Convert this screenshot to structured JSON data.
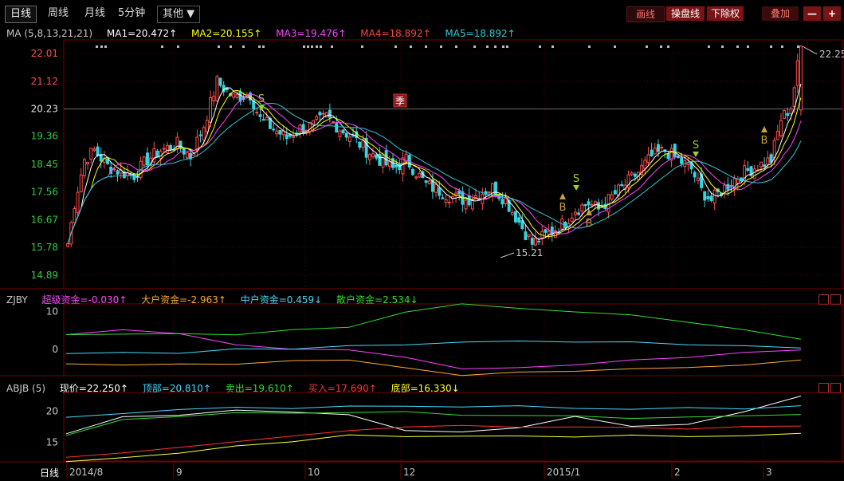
{
  "toolbar": {
    "tabs": [
      "日线",
      "周线",
      "月线",
      "5分钟",
      "其他 ▼"
    ],
    "draw_label": "画线",
    "operate_label": "操盘线",
    "exright_label": "下除权",
    "overlay_label": "叠加",
    "minus_label": "—",
    "plus_label": "+"
  },
  "ma_legend": {
    "prefix": "MA (5,8,13,21,21)",
    "items": [
      {
        "text": "MA1=20.472↑",
        "color": "#ffffff"
      },
      {
        "text": "MA2=20.155↑",
        "color": "#ffff00"
      },
      {
        "text": "MA3=19.476↑",
        "color": "#ff44ff"
      },
      {
        "text": "MA4=18.892↑",
        "color": "#ff4040"
      },
      {
        "text": "MA5=18.892↑",
        "color": "#2ec8d8"
      }
    ]
  },
  "zjby_legend": {
    "prefix": "ZJBY",
    "items": [
      {
        "text": "超级资金=-0.030↑",
        "color": "#ff44ff"
      },
      {
        "text": "大户资金=-2.963↑",
        "color": "#ffaa33"
      },
      {
        "text": "中户资金=0.459↓",
        "color": "#4ad8ff"
      },
      {
        "text": "散户资金=2.534↓",
        "color": "#33dd33"
      }
    ]
  },
  "abjb_legend": {
    "prefix": "ABJB (5)",
    "items": [
      {
        "text": "现价=22.250↑",
        "color": "#ffffff"
      },
      {
        "text": "顶部=20.810↑",
        "color": "#4ad8ff"
      },
      {
        "text": "卖出=19.610↑",
        "color": "#33dd33"
      },
      {
        "text": "买入=17.690↑",
        "color": "#ff3333"
      },
      {
        "text": "底部=16.330↓",
        "color": "#ffff33"
      }
    ]
  },
  "x_axis": {
    "label": "日线",
    "ticks": [
      "2014/8",
      "9",
      "10",
      "12",
      "2015/1",
      "2",
      "3"
    ]
  },
  "chart_data": [
    {
      "type": "candlestick",
      "y_ticks": [
        22.01,
        21.12,
        20.23,
        19.36,
        18.45,
        17.56,
        16.67,
        15.78,
        14.89
      ],
      "ylim": [
        14.45,
        22.45
      ],
      "annotations": [
        "22.25",
        "15.21",
        "季",
        "S",
        "B"
      ],
      "price_path": [
        [
          0,
          15.9
        ],
        [
          2,
          17.2
        ],
        [
          5,
          18.6
        ],
        [
          8,
          18.9
        ],
        [
          12,
          18.4
        ],
        [
          16,
          18.2
        ],
        [
          20,
          18.1
        ],
        [
          24,
          18.6
        ],
        [
          28,
          18.9
        ],
        [
          33,
          19.1
        ],
        [
          37,
          18.7
        ],
        [
          41,
          19.7
        ],
        [
          45,
          21.1
        ],
        [
          50,
          20.6
        ],
        [
          55,
          20.7
        ],
        [
          58,
          19.9
        ],
        [
          62,
          19.6
        ],
        [
          66,
          19.3
        ],
        [
          70,
          19.6
        ],
        [
          74,
          19.7
        ],
        [
          78,
          20.0
        ],
        [
          82,
          19.6
        ],
        [
          86,
          19.3
        ],
        [
          90,
          18.9
        ],
        [
          94,
          18.6
        ],
        [
          98,
          18.3
        ],
        [
          102,
          18.6
        ],
        [
          105,
          18.2
        ],
        [
          108,
          17.8
        ],
        [
          112,
          17.6
        ],
        [
          116,
          17.4
        ],
        [
          120,
          17.3
        ],
        [
          124,
          17.5
        ],
        [
          128,
          17.7
        ],
        [
          132,
          17.3
        ],
        [
          136,
          16.6
        ],
        [
          140,
          15.9
        ],
        [
          143,
          16.1
        ],
        [
          146,
          16.3
        ],
        [
          150,
          16.6
        ],
        [
          153,
          17.0
        ],
        [
          157,
          17.2
        ],
        [
          160,
          17.0
        ],
        [
          164,
          17.4
        ],
        [
          168,
          17.8
        ],
        [
          172,
          18.2
        ],
        [
          176,
          18.7
        ],
        [
          180,
          18.9
        ],
        [
          184,
          18.6
        ],
        [
          188,
          18.3
        ],
        [
          191,
          17.6
        ],
        [
          194,
          17.3
        ],
        [
          197,
          17.6
        ],
        [
          200,
          17.9
        ],
        [
          204,
          18.2
        ],
        [
          208,
          18.4
        ],
        [
          212,
          18.6
        ],
        [
          215,
          19.9
        ],
        [
          218,
          20.3
        ],
        [
          221,
          22.25
        ]
      ],
      "candle_count": 222
    },
    {
      "type": "line",
      "ylim": [
        -7,
        12
      ],
      "y_ticks": [
        10,
        0
      ],
      "series": [
        {
          "name": "超级资金",
          "color": "#ff44ff",
          "values": [
            4,
            5,
            4,
            1,
            0,
            0,
            -2,
            -5,
            -5,
            -4,
            -3,
            -2,
            -1,
            0
          ]
        },
        {
          "name": "大户资金",
          "color": "#ffaa33",
          "values": [
            -4,
            -4,
            -4,
            -4,
            -3,
            -3,
            -5,
            -7,
            -6,
            -6,
            -5,
            -5,
            -4,
            -3
          ]
        },
        {
          "name": "中户资金",
          "color": "#4ad8ff",
          "values": [
            -1,
            -1,
            -1,
            0,
            0,
            1,
            1,
            2,
            2,
            2,
            2,
            1,
            1,
            0.5
          ]
        },
        {
          "name": "散户资金",
          "color": "#33dd33",
          "values": [
            4,
            4,
            4,
            4,
            5,
            6,
            10,
            12,
            11,
            10,
            9,
            7,
            5,
            2.5
          ]
        }
      ]
    },
    {
      "type": "line",
      "ylim": [
        12,
        23
      ],
      "y_ticks": [
        20,
        15
      ],
      "series": [
        {
          "name": "现价",
          "color": "#ffffff",
          "values": [
            16.5,
            19,
            19.5,
            20,
            20,
            19.5,
            17,
            16.5,
            17.5,
            19,
            17.5,
            18,
            20,
            22.25
          ]
        },
        {
          "name": "顶部",
          "color": "#4ad8ff",
          "values": [
            19,
            19.6,
            20.3,
            20.5,
            20.6,
            20.7,
            20.8,
            20.8,
            20.7,
            20.5,
            20.4,
            20.4,
            20.5,
            20.8
          ]
        },
        {
          "name": "卖出",
          "color": "#33dd33",
          "values": [
            16.2,
            18.5,
            19.3,
            19.6,
            19.8,
            19.8,
            19.8,
            19.5,
            19.3,
            19.1,
            19.0,
            19.0,
            19.2,
            19.6
          ]
        },
        {
          "name": "买入",
          "color": "#ff3333",
          "values": [
            12.6,
            13.3,
            14.2,
            15.1,
            16.0,
            16.9,
            17.5,
            17.6,
            17.6,
            17.4,
            17.3,
            17.3,
            17.4,
            17.7
          ]
        },
        {
          "name": "底部",
          "color": "#ffff33",
          "values": [
            12,
            12.4,
            13.4,
            14.3,
            15.2,
            16.1,
            16.1,
            15.9,
            16.0,
            16.0,
            16.0,
            16.0,
            16.1,
            16.3
          ]
        }
      ]
    }
  ]
}
